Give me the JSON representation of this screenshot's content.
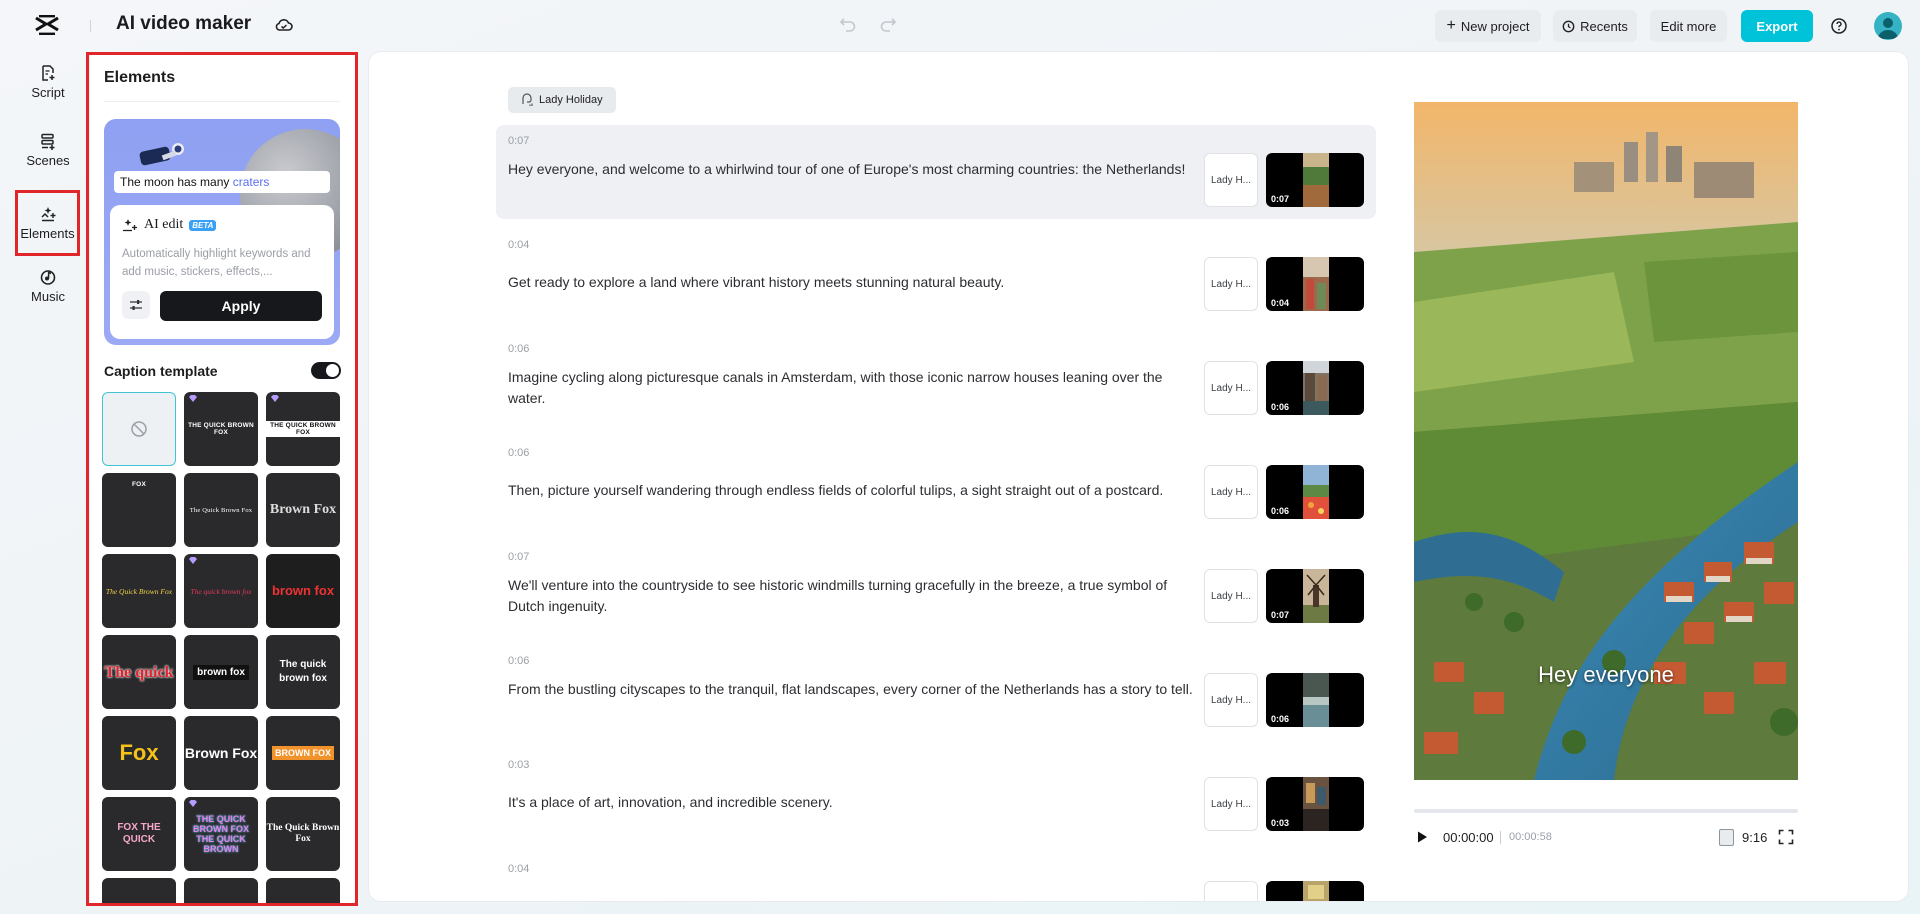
{
  "header": {
    "app_title": "AI video maker",
    "new_project": "New project",
    "recents": "Recents",
    "edit_more": "Edit more",
    "export": "Export",
    "accent_color": "#00c2d9"
  },
  "sidebar": {
    "items": [
      {
        "label": "Script",
        "icon": "script-icon"
      },
      {
        "label": "Scenes",
        "icon": "scenes-icon"
      },
      {
        "label": "Elements",
        "icon": "elements-icon",
        "selected": true
      },
      {
        "label": "Music",
        "icon": "music-icon"
      }
    ]
  },
  "elements_panel": {
    "title": "Elements",
    "ai_card": {
      "caption_prefix": "The moon has many",
      "caption_keyword": "craters",
      "ai_edit_label": "AI edit",
      "beta": "BETA",
      "description": "Automatically highlight keywords and add music, stickers, effects,...",
      "apply_label": "Apply"
    },
    "caption_template": {
      "label": "Caption template",
      "enabled": true,
      "templates": [
        {
          "name": "none",
          "text": ""
        },
        {
          "name": "quick-brown-fox-caps",
          "text": "THE QUICK BROWN FOX"
        },
        {
          "name": "highlight-bar",
          "text": "THE QUICK BROWN FOX"
        },
        {
          "name": "fox-small",
          "text": "FOX"
        },
        {
          "name": "serif-quick-brown-fox",
          "text": "The Quick Brown Fox"
        },
        {
          "name": "brown-fox-serif",
          "text": "Brown Fox"
        },
        {
          "name": "script-yellow",
          "text": "The Quick Brown Fox"
        },
        {
          "name": "script-red",
          "text": "The quick brown fox"
        },
        {
          "name": "brown-fox-red",
          "text": "brown fox"
        },
        {
          "name": "the-quick-red",
          "text": "The quick"
        },
        {
          "name": "brown-fox-dark",
          "text": "brown fox"
        },
        {
          "name": "the-quick-brown-fox-yellow",
          "text": "The quick brown fox"
        },
        {
          "name": "fox-yellow",
          "text": "Fox"
        },
        {
          "name": "brown-fox-bold",
          "text": "Brown Fox"
        },
        {
          "name": "brown-fox-orange",
          "text": "BROWN FOX"
        },
        {
          "name": "fox-the-quick-pink",
          "text": "FOX THE QUICK"
        },
        {
          "name": "neon-stack",
          "text": "THE QUICK BROWN FOX THE QUICK BROWN"
        },
        {
          "name": "the-quick-brown-fox-box",
          "text": "The Quick Brown Fox"
        }
      ]
    }
  },
  "script": {
    "voice": "Lady Holiday",
    "scenes": [
      {
        "time": "0:07",
        "text": "Hey everyone, and welcome to a whirlwind tour of one of Europe's most charming countries: the Netherlands!",
        "voice": "Lady H...",
        "duration": "0:07",
        "active": true
      },
      {
        "time": "0:04",
        "text": "Get ready to explore a land where vibrant history meets stunning natural beauty.",
        "voice": "Lady H...",
        "duration": "0:04"
      },
      {
        "time": "0:06",
        "text": "Imagine cycling along picturesque canals in Amsterdam, with those iconic narrow houses leaning over the water.",
        "voice": "Lady H...",
        "duration": "0:06"
      },
      {
        "time": "0:06",
        "text": "Then, picture yourself wandering through endless fields of colorful tulips, a sight straight out of a postcard.",
        "voice": "Lady H...",
        "duration": "0:06"
      },
      {
        "time": "0:07",
        "text": "We'll venture into the countryside to see historic windmills turning gracefully in the breeze, a true symbol of Dutch ingenuity.",
        "voice": "Lady H...",
        "duration": "0:07"
      },
      {
        "time": "0:06",
        "text": "From the bustling cityscapes to the tranquil, flat landscapes, every corner of the Netherlands has a story to tell.",
        "voice": "Lady H...",
        "duration": "0:06"
      },
      {
        "time": "0:03",
        "text": "It's a place of art, innovation, and incredible scenery.",
        "voice": "Lady H...",
        "duration": "0:03"
      },
      {
        "time": "0:04",
        "text": "",
        "voice": "",
        "duration": ""
      }
    ]
  },
  "preview": {
    "caption": "Hey everyone",
    "current_time": "00:00:00",
    "total_time": "00:00:58",
    "aspect_ratio": "9:16",
    "progress": 0
  }
}
